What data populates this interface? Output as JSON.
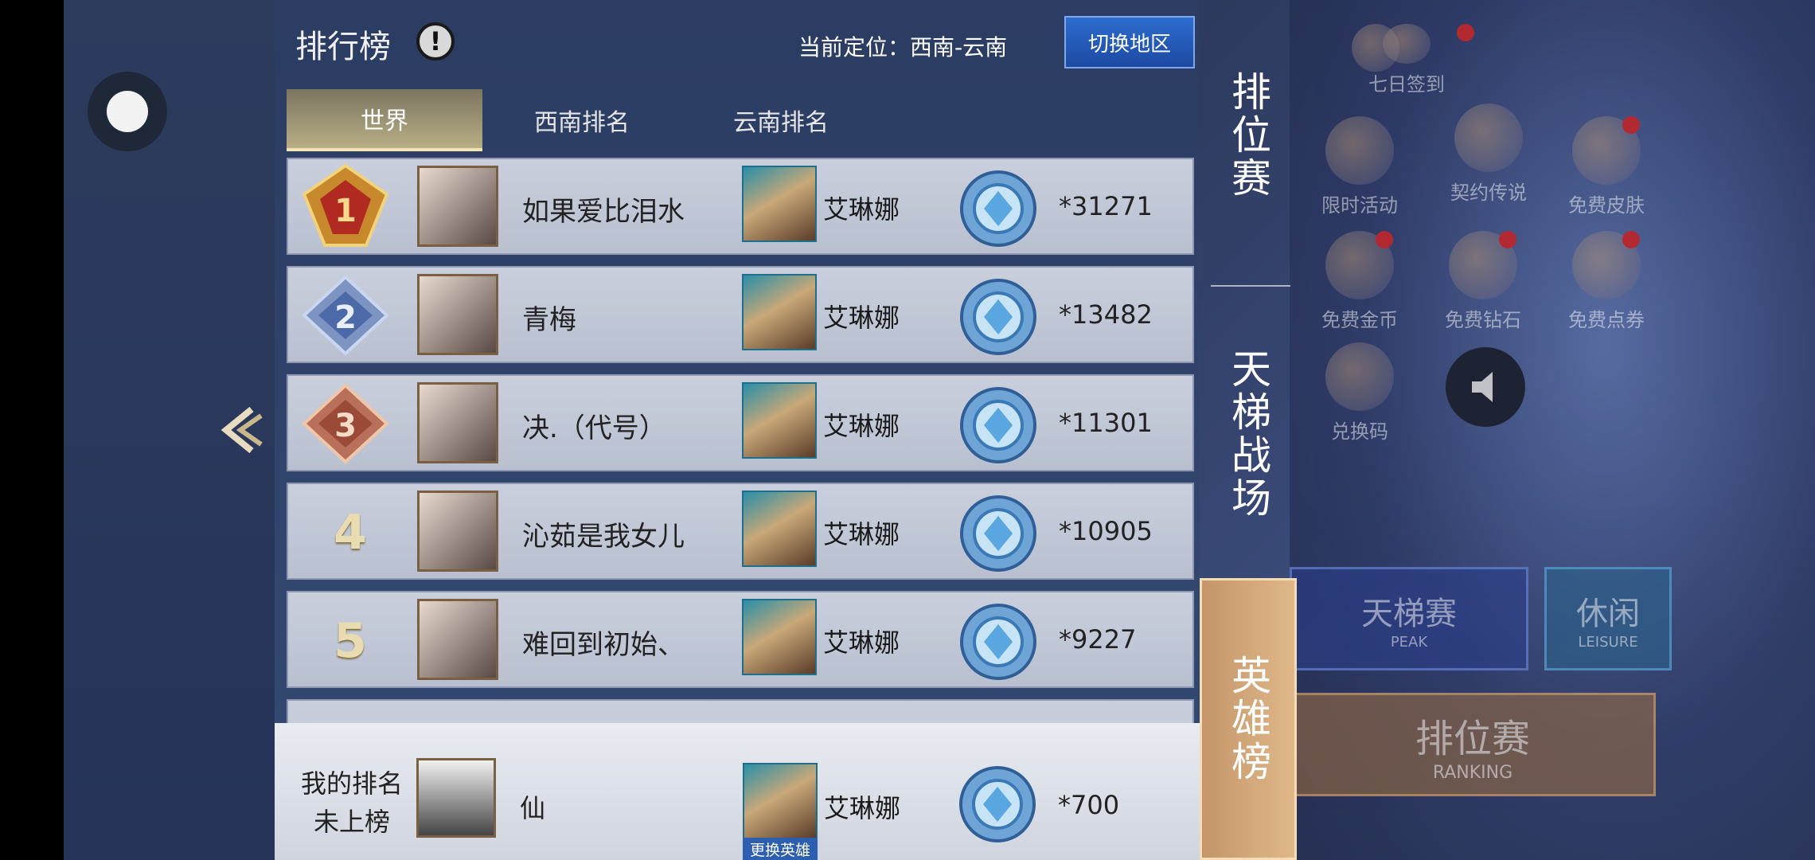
{
  "header": {
    "title": "排行榜",
    "info_icon": "!",
    "location": "当前定位：西南-云南",
    "switch_button": "切换地区"
  },
  "tabs": [
    {
      "label": "世界",
      "active": true
    },
    {
      "label": "西南排名",
      "active": false
    },
    {
      "label": "云南排名",
      "active": false
    }
  ],
  "rankings": [
    {
      "rank": "1",
      "name": "如果爱比泪水",
      "hero": "艾琳娜",
      "score": "*31271"
    },
    {
      "rank": "2",
      "name": "青梅",
      "hero": "艾琳娜",
      "score": "*13482"
    },
    {
      "rank": "3",
      "name": "决.（代号）",
      "hero": "艾琳娜",
      "score": "*11301"
    },
    {
      "rank": "4",
      "name": "沁茹是我女儿",
      "hero": "艾琳娜",
      "score": "*10905"
    },
    {
      "rank": "5",
      "name": "难回到初始、",
      "hero": "艾琳娜",
      "score": "*9227"
    }
  ],
  "my_rank": {
    "label": "我的排名",
    "status": "未上榜",
    "name": "仙",
    "hero": "艾琳娜",
    "change_hero": "更换英雄",
    "score": "*700"
  },
  "side_tabs": [
    {
      "label": "排位赛",
      "active": false
    },
    {
      "label": "天梯战场",
      "active": false
    },
    {
      "label": "英雄榜",
      "active": true
    }
  ],
  "background": {
    "top_icons": [
      "七日签到"
    ],
    "activity_icons": [
      "限时活动",
      "契约传说",
      "免费皮肤",
      "免费金币",
      "免费钻石",
      "免费点券",
      "兑换码"
    ],
    "modes": [
      {
        "label": "天梯赛",
        "sub": "PEAK"
      },
      {
        "label": "休闲",
        "sub": "LEISURE"
      },
      {
        "label": "排位赛",
        "sub": "RANKING"
      }
    ]
  },
  "colors": {
    "accent_blue": "#1c4aa2",
    "active_tab_gold": "#b8ae86",
    "row_bg": "#c9cfdc",
    "side_tab_active": "#c4966a"
  }
}
